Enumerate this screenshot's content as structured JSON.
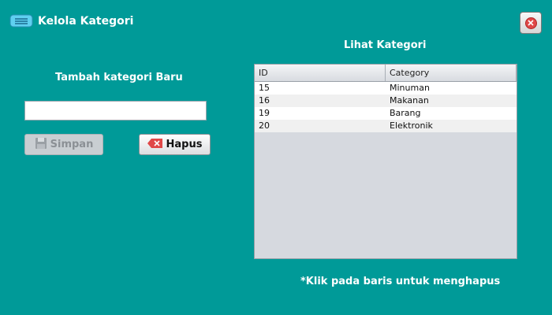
{
  "window": {
    "title": "Kelola Kategori",
    "icon": "card-icon",
    "close_icon": "close-icon"
  },
  "form": {
    "title": "Tambah kategori Baru",
    "input_value": "",
    "input_placeholder": "",
    "save_label": "Simpan",
    "save_icon": "floppy-disk-icon",
    "delete_label": "Hapus",
    "delete_icon": "delete-icon"
  },
  "list": {
    "title": "Lihat Kategori",
    "columns": [
      "ID",
      "Category"
    ],
    "rows": [
      [
        "15",
        "Minuman"
      ],
      [
        "16",
        "Makanan"
      ],
      [
        "19",
        "Barang"
      ],
      [
        "20",
        "Elektronik"
      ]
    ],
    "note": "*Klik pada baris untuk menghapus"
  },
  "colors": {
    "background": "#009a98",
    "close_accent": "#e04848",
    "delete_accent": "#e04848"
  }
}
